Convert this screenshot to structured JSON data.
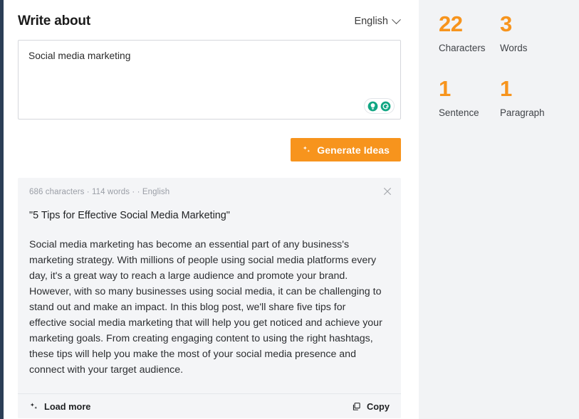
{
  "left_rail": {
    "color": "#2c3e56"
  },
  "header": {
    "title": "Write about",
    "language": "English",
    "chevron_icon": "chevron-down-icon"
  },
  "input": {
    "value": "Social media marketing",
    "placeholder": "Write about",
    "tools": [
      {
        "icon": "lightbulb-icon",
        "color": "#11a683"
      },
      {
        "icon": "grammarly-logo-icon",
        "color": "#11a683"
      }
    ]
  },
  "generate_button": {
    "label": "Generate Ideas",
    "icon": "sparkle-icon",
    "background": "#f7941d",
    "text_color": "#ffffff"
  },
  "result": {
    "meta": "686 characters · 114 words · · English",
    "close_icon": "close-icon",
    "title": "\"5 Tips for Effective Social Media Marketing\"",
    "body": "Social media marketing has become an essential part of any business's marketing strategy. With millions of people using social media platforms every day, it's a great way to reach a large audience and promote your brand. However, with so many businesses using social media, it can be challenging to stand out and make an impact. In this blog post, we'll share five tips for effective social media marketing that will help you get noticed and achieve your marketing goals. From creating engaging content to using the right hashtags, these tips will help you make the most of your social media presence and connect with your target audience.",
    "footer": {
      "load_more_label": "Load more",
      "load_more_icon": "sparkle-icon",
      "copy_label": "Copy",
      "copy_icon": "copy-icon"
    }
  },
  "stats": {
    "accent_color": "#f7941d",
    "background": "#f2f3f5",
    "items": [
      {
        "value": "22",
        "label": "Characters"
      },
      {
        "value": "3",
        "label": "Words"
      },
      {
        "value": "1",
        "label": "Sentence"
      },
      {
        "value": "1",
        "label": "Paragraph"
      }
    ]
  }
}
